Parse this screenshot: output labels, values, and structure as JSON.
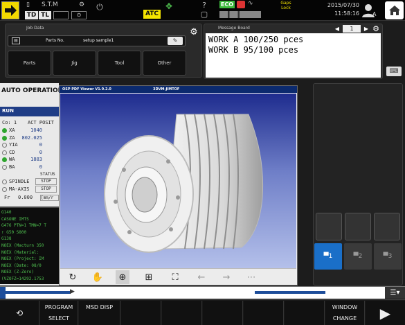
{
  "status_bar": {
    "td_label": "TD",
    "tl_label": "TL",
    "stm_label": "S.T.M",
    "atc_label": "ATC",
    "eco_label": "ECO",
    "gaps_lock_label": "Gaps Lock",
    "date": "2015/07/30",
    "time": "11:58:16",
    "user_label": "A"
  },
  "job_data": {
    "title": "Job Data",
    "parts_no_label": "Parts No.",
    "parts_no_value": "setup sample1",
    "buttons": [
      "Parts",
      "Jig",
      "Tool",
      "Other"
    ]
  },
  "message_board": {
    "title": "Message Board",
    "page": "1",
    "lines": [
      "WORK A 100/250 pces",
      "WORK B 95/100 pces"
    ]
  },
  "operation": {
    "mode": "AUTO OPERATION",
    "state": "RUN",
    "co_label": "Co:",
    "co_value": "1",
    "act_posit_label": "ACT POSIT",
    "axes": [
      {
        "name": "XA",
        "value": "1040",
        "dot": "green"
      },
      {
        "name": "ZA",
        "value": "802.025",
        "dot": "green"
      },
      {
        "name": "YIA",
        "value": "0",
        "dot": "none"
      },
      {
        "name": "CD",
        "value": "0",
        "dot": "none"
      },
      {
        "name": "WA",
        "value": "1883",
        "dot": "green"
      },
      {
        "name": "BA",
        "value": "0",
        "dot": "none"
      }
    ],
    "status_label": "STATUS",
    "spindle_label": "SPINDLE",
    "spindle_status": "STOP",
    "ma_axis_label": "MA-AXIS",
    "ma_axis_status": "STOP",
    "fr_label": "Fr",
    "fr_value": "0.000",
    "fr_unit": "[mm/r"
  },
  "program": {
    "lines": [
      "G140",
      "CASONE IMTS",
      "G476 PTN=1 TMN=7 T",
      "↑ G50  S800",
      "G138",
      "NOEX (Macturn 350",
      "NOEX (Material: ",
      "NOEX (Project: IM",
      "NOEX (Date: 08/0",
      "NOEX (Z-Zero)",
      "(VZOFZ=14292.1753"
    ]
  },
  "pdf_viewer": {
    "title": "OSP PDF Viewer V1.0.2.0",
    "doc_title": "3DVM-JIMTOF"
  },
  "tabs": [
    "1",
    "2",
    "3"
  ],
  "softkeys": {
    "program_select": [
      "PROGRAM",
      "SELECT"
    ],
    "msd_disp": "MSD DISP",
    "window_change": [
      "WINDOW",
      "CHANGE"
    ]
  },
  "colors": {
    "accent_yellow": "#f5e400",
    "accent_blue": "#1a6fc8",
    "program_green": "#4fc04f"
  }
}
